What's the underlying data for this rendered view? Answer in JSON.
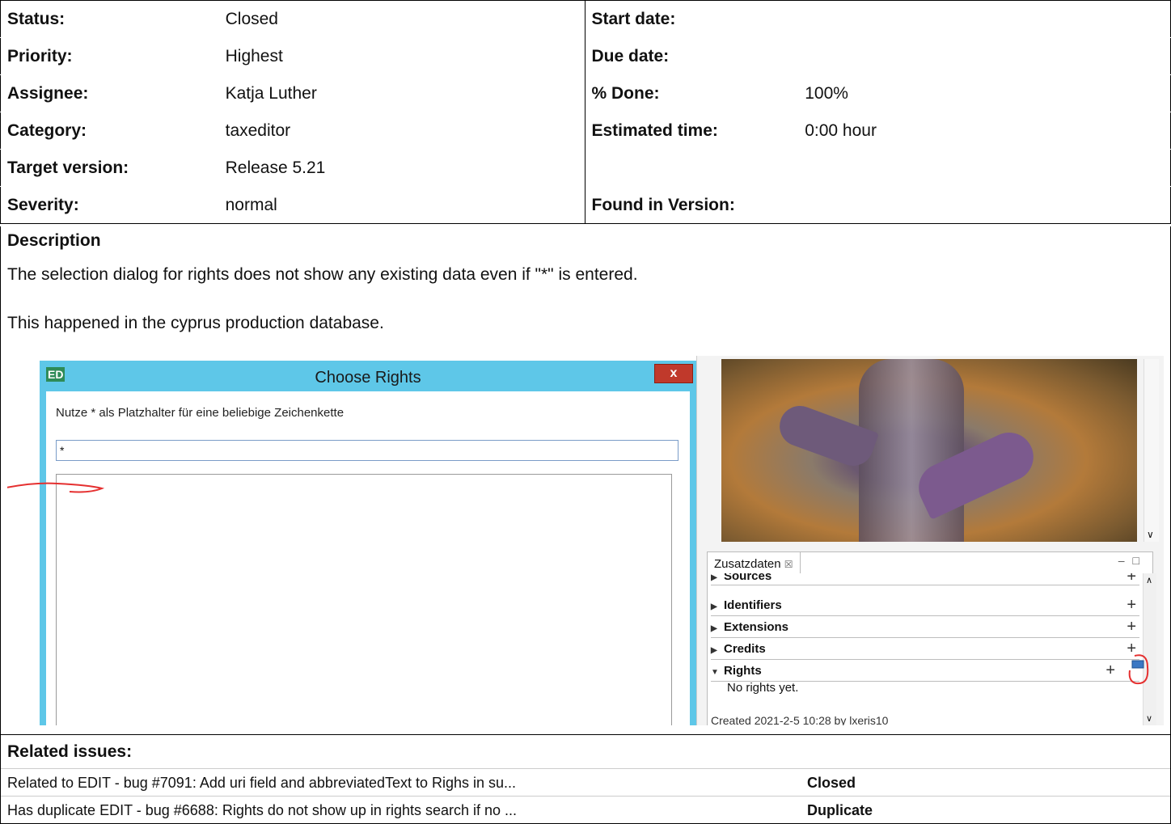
{
  "attributes": {
    "left": [
      {
        "label": "Status:",
        "value": "Closed"
      },
      {
        "label": "Priority:",
        "value": "Highest"
      },
      {
        "label": "Assignee:",
        "value": "Katja Luther"
      },
      {
        "label": "Category:",
        "value": "taxeditor"
      },
      {
        "label": "Target version:",
        "value": "Release 5.21"
      },
      {
        "label": "Severity:",
        "value": "normal"
      }
    ],
    "right": [
      {
        "label": "Start date:",
        "value": ""
      },
      {
        "label": "Due date:",
        "value": ""
      },
      {
        "label": "% Done:",
        "value": "100%"
      },
      {
        "label": "Estimated time:",
        "value": "0:00 hour"
      },
      {
        "label": "",
        "value": ""
      },
      {
        "label": "Found in Version:",
        "value": ""
      }
    ]
  },
  "description": {
    "heading": "Description",
    "paragraph1": "The selection dialog for rights does not show any existing data even if \"*\" is entered.",
    "paragraph2": "This happened in the cyprus production database."
  },
  "screenshot": {
    "dialog": {
      "icon": "ED",
      "title": "Choose Rights",
      "close": "x",
      "hint": "Nutze * als Platzhalter für eine beliebige Zeichenkette",
      "input_value": "*"
    },
    "panel": {
      "tab_label": "Zusatzdaten",
      "tab_close": "☒",
      "sections": [
        {
          "label": "Sources",
          "expanded": false
        },
        {
          "label": "Identifiers",
          "expanded": false
        },
        {
          "label": "Extensions",
          "expanded": false
        },
        {
          "label": "Credits",
          "expanded": false
        },
        {
          "label": "Rights",
          "expanded": true
        }
      ],
      "plus": "+",
      "no_rights": "No rights yet.",
      "created": "Created 2021-2-5 10:28 by lxeris10"
    },
    "annotation_color": "#e53030"
  },
  "related": {
    "heading": "Related issues:",
    "items": [
      {
        "text": "Related to EDIT - bug #7091: Add uri field and abbreviatedText to Righs in su...",
        "status": "Closed"
      },
      {
        "text": "Has duplicate EDIT - bug #6688: Rights do not show up in rights search if no ...",
        "status": "Duplicate"
      }
    ]
  }
}
